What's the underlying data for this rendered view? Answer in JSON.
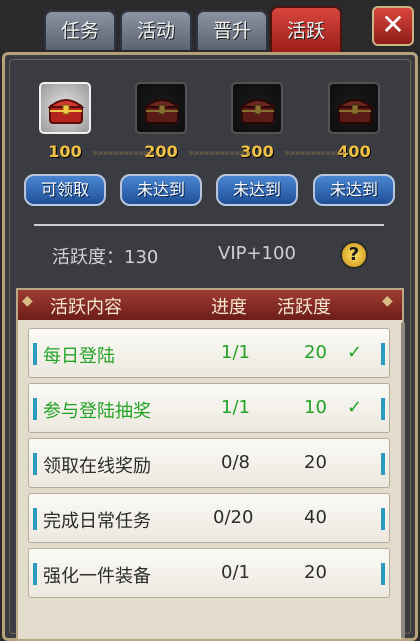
{
  "tabs": [
    "任务",
    "活动",
    "晋升",
    "活跃"
  ],
  "close_label": "✕",
  "milestones": [
    "100",
    "200",
    "300",
    "400"
  ],
  "buttons": [
    "可领取",
    "未达到",
    "未达到",
    "未达到"
  ],
  "activity_text": "活跃度：130",
  "vip_text": "VIP+100",
  "help_label": "?",
  "table": {
    "headers": [
      "活跃内容",
      "进度",
      "活跃度"
    ],
    "rows": [
      {
        "name": "每日登陆",
        "progress": "1/1",
        "points": "20",
        "check": "✓"
      },
      {
        "name": "参与登陆抽奖",
        "progress": "1/1",
        "points": "10",
        "check": "✓"
      },
      {
        "name": "领取在线奖励",
        "progress": "0/8",
        "points": "20",
        "check": ""
      },
      {
        "name": "完成日常任务",
        "progress": "0/20",
        "points": "40",
        "check": ""
      },
      {
        "name": "强化一件装备",
        "progress": "0/1",
        "points": "20",
        "check": ""
      }
    ]
  },
  "colors": {
    "active_tab": "#c13a31",
    "done_text": "#23a326",
    "milestone": "#f4c242",
    "claim_button": "#2f66b4"
  }
}
